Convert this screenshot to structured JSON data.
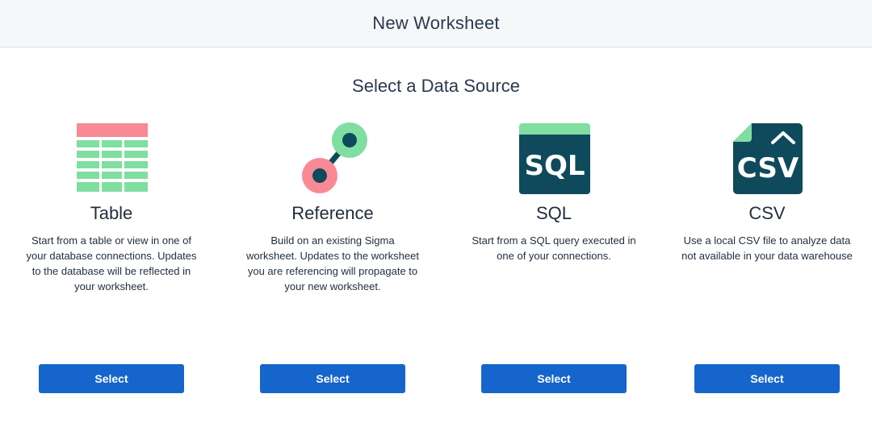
{
  "header": {
    "title": "New Worksheet"
  },
  "main": {
    "subtitle": "Select a Data Source",
    "cards": [
      {
        "icon": "table-icon",
        "title": "Table",
        "description": "Start from a table or view in one of your database connections. Updates to the database will be reflected in your worksheet.",
        "button_label": "Select"
      },
      {
        "icon": "reference-icon",
        "title": "Reference",
        "description": "Build on an existing Sigma worksheet. Updates to the worksheet you are referencing will propagate to your new worksheet.",
        "button_label": "Select"
      },
      {
        "icon": "sql-icon",
        "title": "SQL",
        "description": "Start from a SQL query executed in one of your connections.",
        "button_label": "Select",
        "icon_text": "SQL"
      },
      {
        "icon": "csv-icon",
        "title": "CSV",
        "description": "Use a local CSV file to analyze data not available in your data warehouse",
        "button_label": "Select",
        "icon_text": "CSV"
      }
    ]
  },
  "colors": {
    "button": "#1665cc",
    "dark_teal": "#0e4a5c",
    "green": "#7fdea0",
    "pink": "#f88a95"
  }
}
